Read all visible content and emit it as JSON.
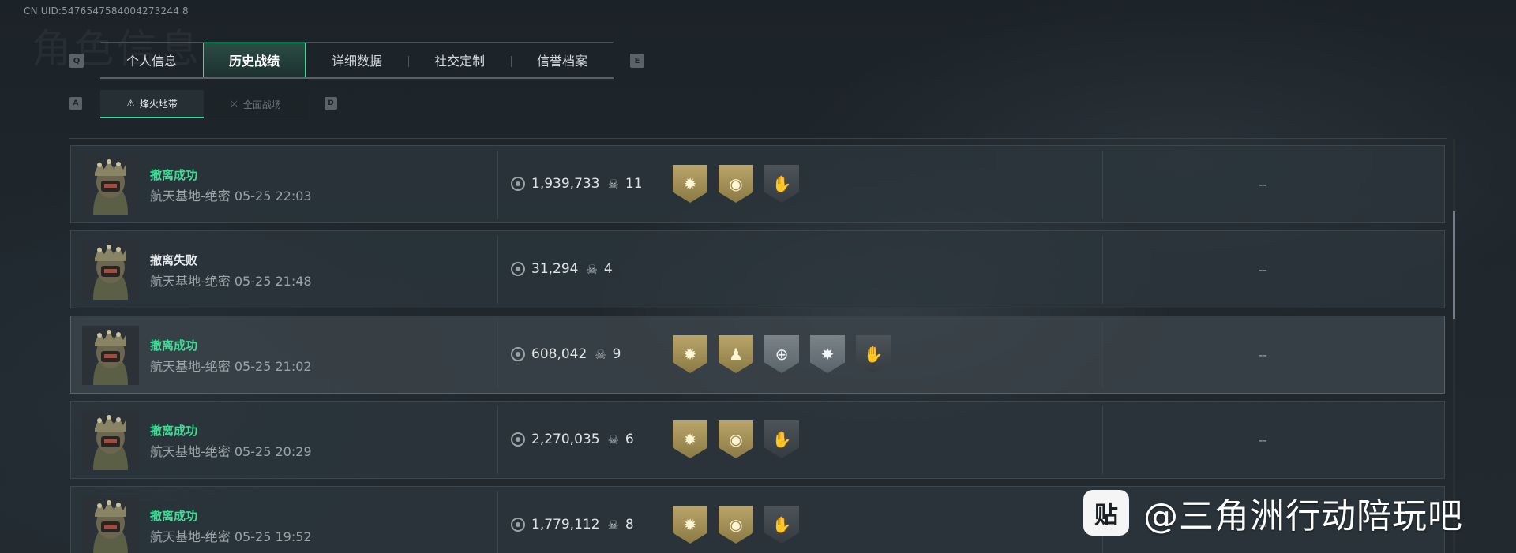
{
  "uid": "CN UID:5476547584004273244 8",
  "header_bg_title": "角色信息",
  "keys": {
    "q": "Q",
    "e": "E",
    "a": "A",
    "d": "D"
  },
  "tabs": [
    {
      "label": "个人信息",
      "active": false
    },
    {
      "label": "历史战绩",
      "active": true
    },
    {
      "label": "详细数据",
      "active": false
    },
    {
      "label": "社交定制",
      "active": false
    },
    {
      "label": "信誉档案",
      "active": false
    }
  ],
  "subtabs": [
    {
      "label": "烽火地带",
      "icon": "hazard-zone-icon",
      "active": true
    },
    {
      "label": "全面战场",
      "icon": "full-battlefield-icon",
      "active": false
    }
  ],
  "colors": {
    "accent": "#3fdc97",
    "success": "#3fdc97",
    "fail": "#e6ebee"
  },
  "matches": [
    {
      "result": "撤离成功",
      "status": "success",
      "map": "航天基地-绝密",
      "time": "05-25 22:03",
      "value": "1,939,733",
      "kills": "11",
      "badges": [
        "gold-sun",
        "gold-circle",
        "gray-hands"
      ],
      "extra": "--"
    },
    {
      "result": "撤离失败",
      "status": "fail",
      "map": "航天基地-绝密",
      "time": "05-25 21:48",
      "value": "31,294",
      "kills": "4",
      "badges": [],
      "extra": "--"
    },
    {
      "result": "撤离成功",
      "status": "success",
      "map": "航天基地-绝密",
      "time": "05-25 21:02",
      "value": "608,042",
      "kills": "9",
      "badges": [
        "gold-sun",
        "gold-figure",
        "silver-crosshair",
        "silver-burst",
        "gray-hands"
      ],
      "extra": "--"
    },
    {
      "result": "撤离成功",
      "status": "success",
      "map": "航天基地-绝密",
      "time": "05-25 20:29",
      "value": "2,270,035",
      "kills": "6",
      "badges": [
        "gold-sun",
        "gold-circle",
        "gray-hands"
      ],
      "extra": "--"
    },
    {
      "result": "撤离成功",
      "status": "success",
      "map": "航天基地-绝密",
      "time": "05-25 19:52",
      "value": "1,779,112",
      "kills": "8",
      "badges": [
        "gold-sun",
        "gold-circle",
        "gray-hands"
      ],
      "extra": "--"
    }
  ],
  "watermark": {
    "icon_text": "贴",
    "text": "@三角洲行动陪玩吧"
  }
}
